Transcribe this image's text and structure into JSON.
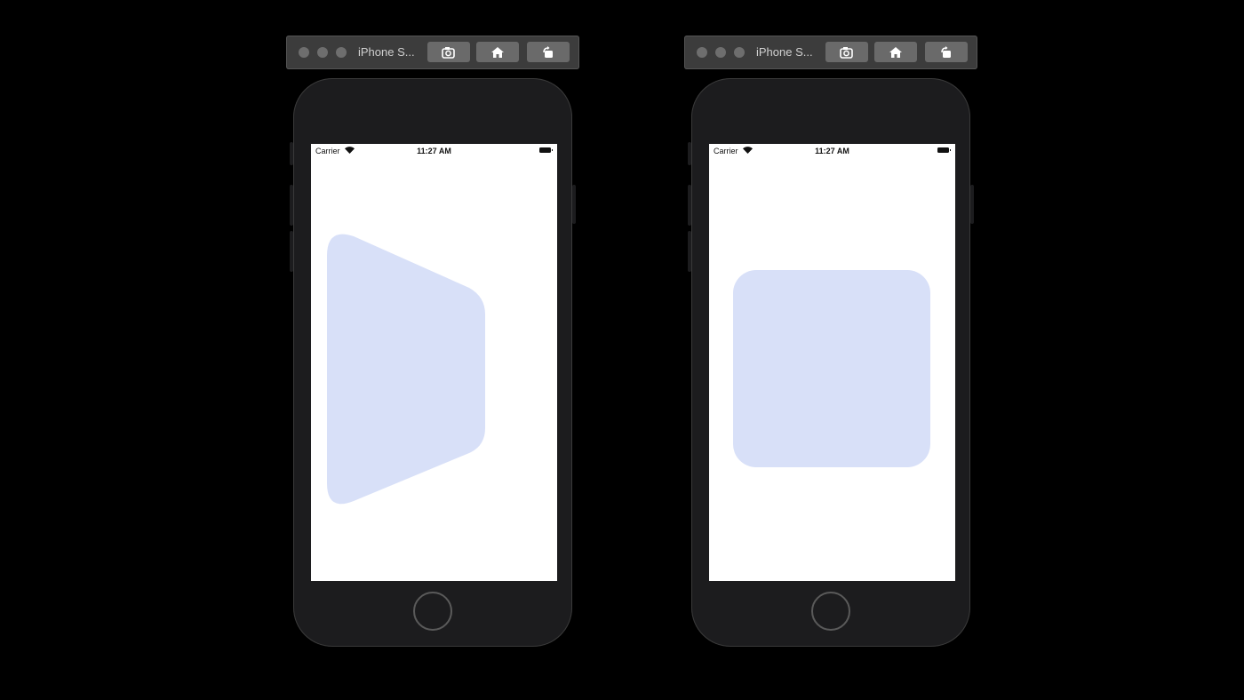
{
  "simulators": [
    {
      "toolbar": {
        "device_name": "iPhone S...",
        "screenshot_icon": "screenshot-icon",
        "home_icon": "home-icon",
        "rotate_icon": "rotate-icon"
      },
      "status_bar": {
        "carrier": "Carrier",
        "time": "11:27 AM"
      },
      "shape": {
        "kind": "tilted-square",
        "color": "#d8e0f8"
      }
    },
    {
      "toolbar": {
        "device_name": "iPhone S...",
        "screenshot_icon": "screenshot-icon",
        "home_icon": "home-icon",
        "rotate_icon": "rotate-icon"
      },
      "status_bar": {
        "carrier": "Carrier",
        "time": "11:27 AM"
      },
      "shape": {
        "kind": "rounded-square",
        "color": "#d8e0f8"
      }
    }
  ]
}
